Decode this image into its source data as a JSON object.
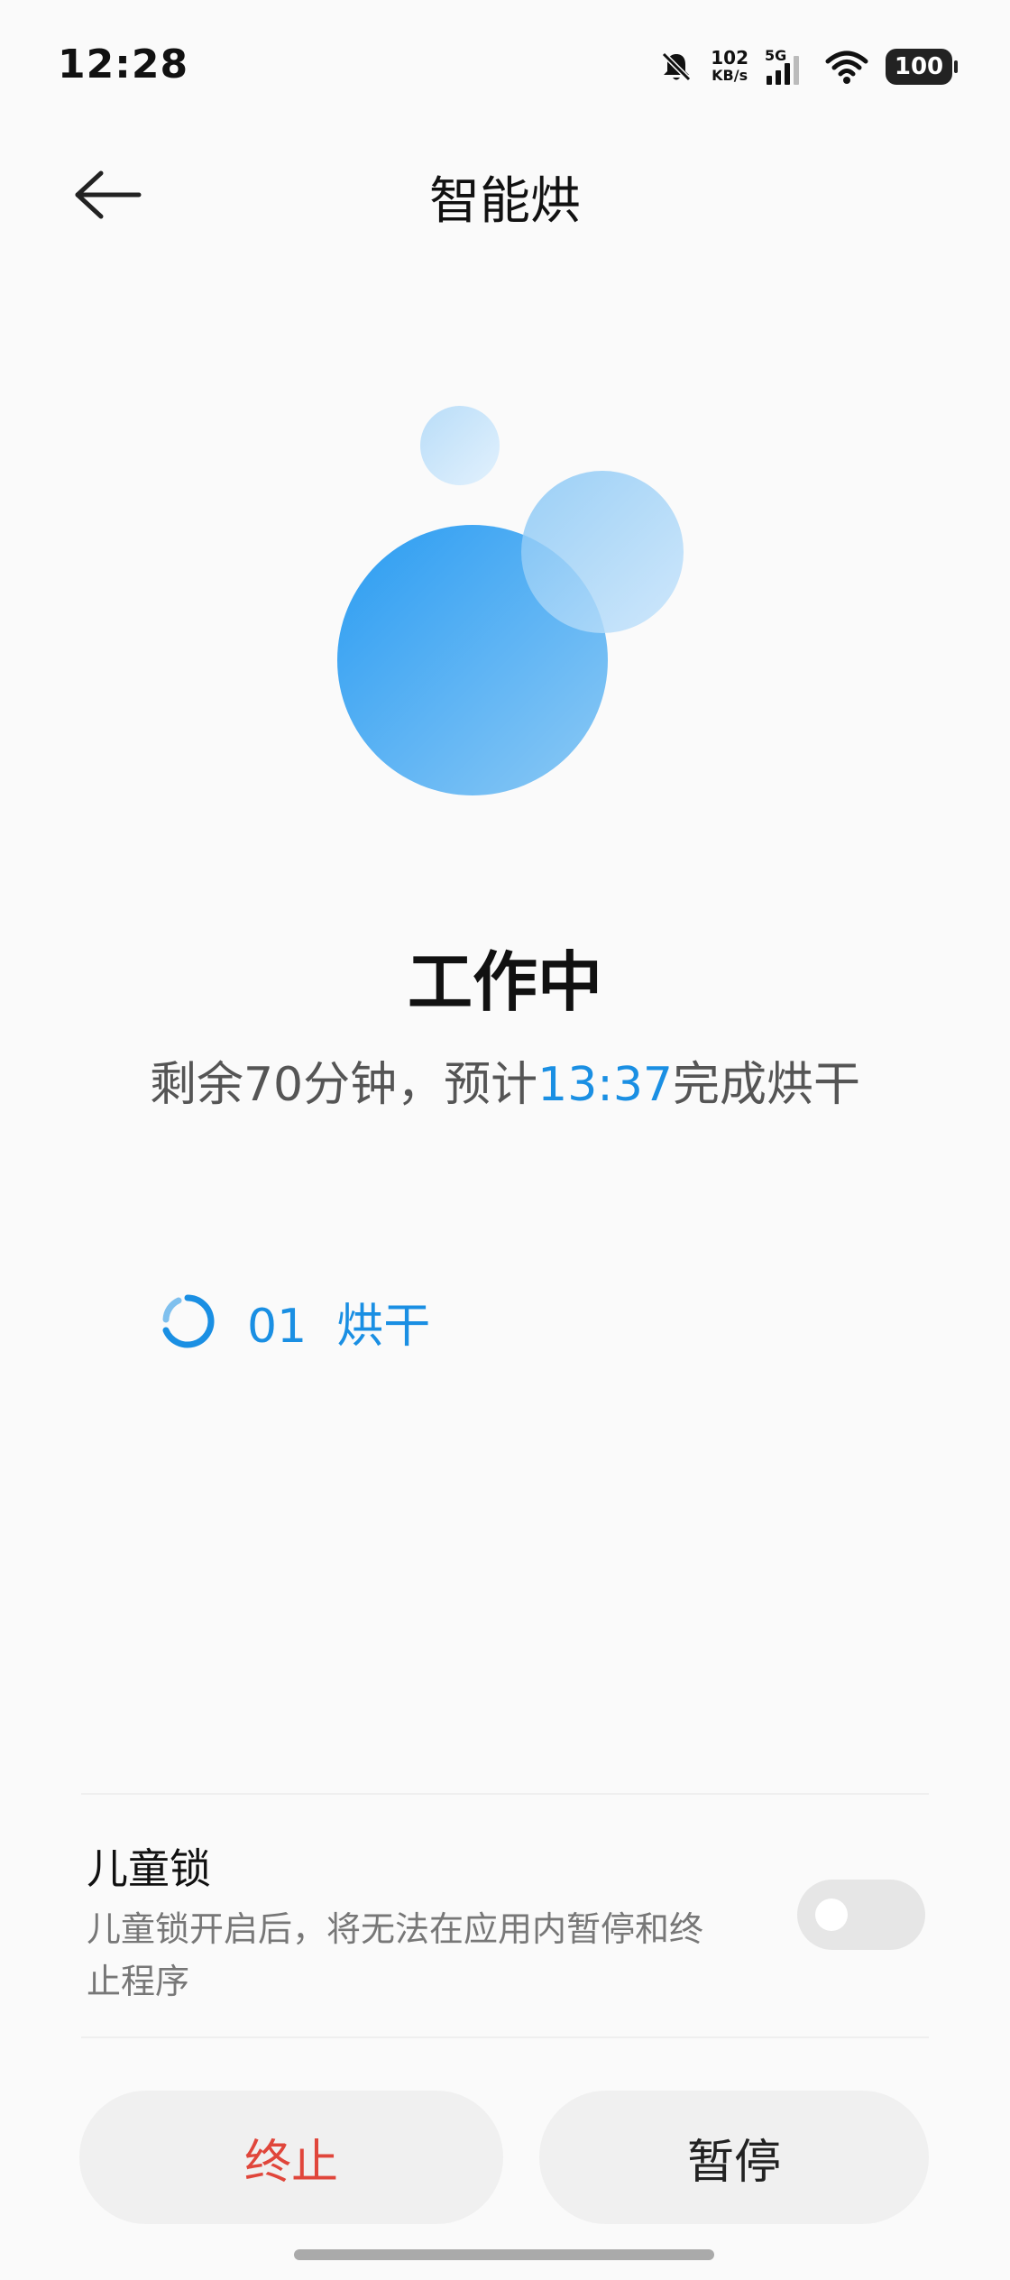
{
  "status_bar": {
    "time": "12:28",
    "net_speed_value": "102",
    "net_speed_unit": "KB/s",
    "network_type": "5G",
    "battery": "100",
    "icons": [
      "bell-off-icon",
      "signal-icon",
      "wifi-icon",
      "battery-icon"
    ]
  },
  "header": {
    "title": "智能烘",
    "back_icon": "arrow-left-icon"
  },
  "status": {
    "title": "工作中",
    "remaining_prefix": "剩余70分钟，预计",
    "finish_time": "13:37",
    "remaining_suffix": "完成烘干"
  },
  "step": {
    "icon": "loading-spinner-icon",
    "label": "01  烘干"
  },
  "child_lock": {
    "title": "儿童锁",
    "description": "儿童锁开启后，将无法在应用内暂停和终止程序",
    "enabled": false
  },
  "buttons": {
    "stop_label": "终止",
    "pause_label": "暂停"
  },
  "colors": {
    "accent": "#1a8fe3",
    "danger": "#e0463b",
    "background": "#fafafa",
    "button_bg": "#f0f0f0"
  }
}
